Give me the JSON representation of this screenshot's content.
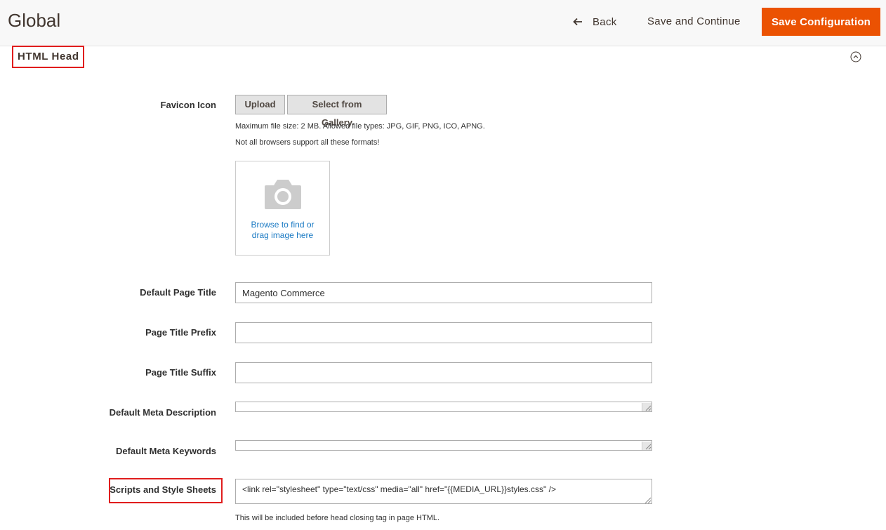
{
  "header": {
    "title": "Global",
    "back_label": "Back",
    "save_continue_label": "Save and Continue",
    "save_config_label": "Save Configuration",
    "accent_color": "#eb5202"
  },
  "section": {
    "title": "HTML Head",
    "collapse_icon": "chevron-up-circle-icon"
  },
  "favicon": {
    "label": "Favicon Icon",
    "upload_label": "Upload",
    "gallery_label": "Select from Gallery",
    "note_size": "Maximum file size: 2 MB. Allowed file types: JPG, GIF, PNG, ICO, APNG.",
    "note_browsers": "Not all browsers support all these formats!",
    "dropzone_text": "Browse to find or drag image here",
    "dropzone_icon": "camera-icon"
  },
  "fields": {
    "default_title_label": "Default Page Title",
    "default_title_value": "Magento Commerce",
    "prefix_label": "Page Title Prefix",
    "prefix_value": "",
    "suffix_label": "Page Title Suffix",
    "suffix_value": "",
    "meta_desc_label": "Default Meta Description",
    "meta_desc_value": "",
    "meta_keywords_label": "Default Meta Keywords",
    "meta_keywords_value": "",
    "scripts_label": "Scripts and Style Sheets",
    "scripts_value": "<link  rel=\"stylesheet\" type=\"text/css\"  media=\"all\" href=\"{{MEDIA_URL}}styles.css\" />",
    "scripts_note": "This will be included before head closing tag in page HTML."
  }
}
